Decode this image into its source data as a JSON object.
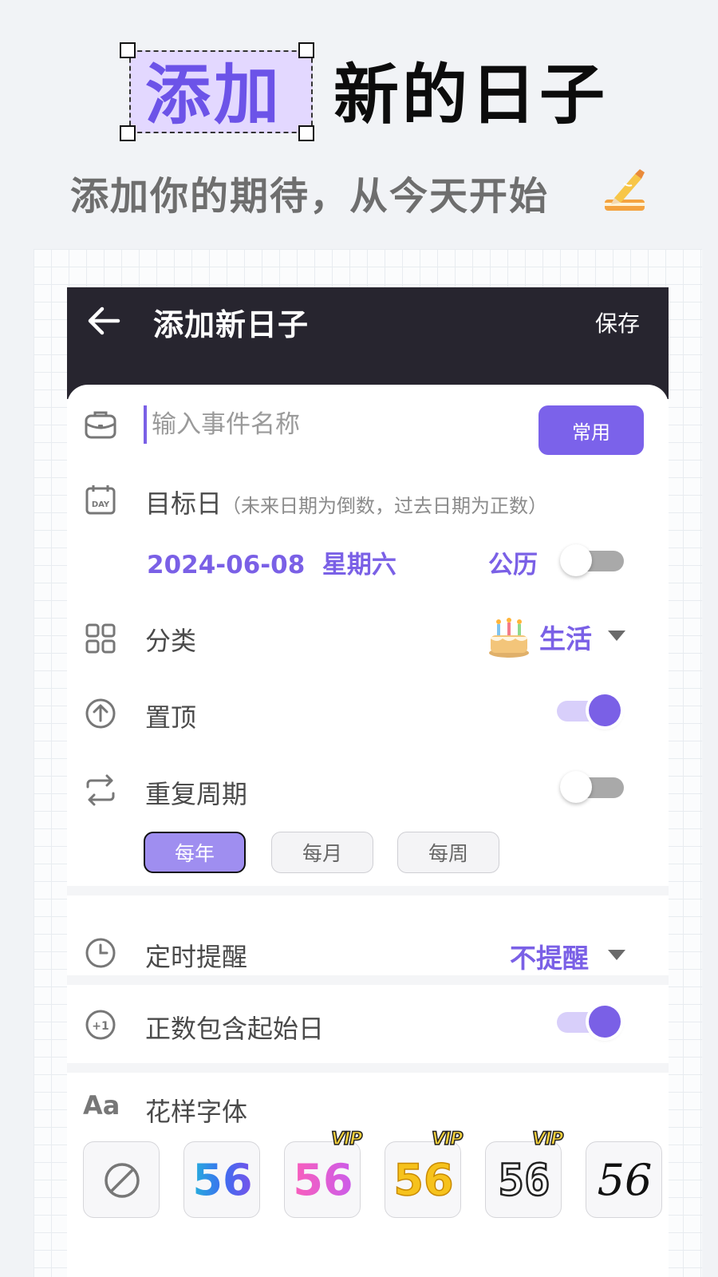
{
  "promo": {
    "headline_accent": "添加",
    "headline_rest": "新的日子",
    "subtitle": "添加你的期待，从今天开始"
  },
  "appbar": {
    "title": "添加新日子",
    "save_label": "保存"
  },
  "event_name": {
    "placeholder": "输入事件名称",
    "value": "",
    "common_button": "常用"
  },
  "target_date": {
    "label": "目标日",
    "hint": "（未来日期为倒数，过去日期为正数）",
    "date": "2024-06-08",
    "weekday": "星期六",
    "calendar_type": "公历",
    "lunar_toggle": false
  },
  "category": {
    "label": "分类",
    "value": "生活",
    "icon": "birthday-cake-icon"
  },
  "pin_top": {
    "label": "置顶",
    "enabled": true
  },
  "repeat": {
    "label": "重复周期",
    "enabled": false,
    "options": [
      "每年",
      "每月",
      "每周"
    ],
    "selected": "每年"
  },
  "reminder": {
    "label": "定时提醒",
    "value": "不提醒"
  },
  "include_start": {
    "label": "正数包含起始日",
    "enabled": true
  },
  "fonts": {
    "label": "花样字体",
    "sample": "56",
    "vip_label": "VIP",
    "styles": [
      {
        "name": "none",
        "vip": false
      },
      {
        "name": "gradient-blue",
        "vip": false
      },
      {
        "name": "gradient-pink",
        "vip": true
      },
      {
        "name": "gold",
        "vip": true
      },
      {
        "name": "outline-block",
        "vip": true
      },
      {
        "name": "handwritten",
        "vip": false
      }
    ]
  },
  "colors": {
    "accent": "#7a60e6",
    "appbar": "#27252f",
    "highlight_bg": "#e3d8ff"
  }
}
